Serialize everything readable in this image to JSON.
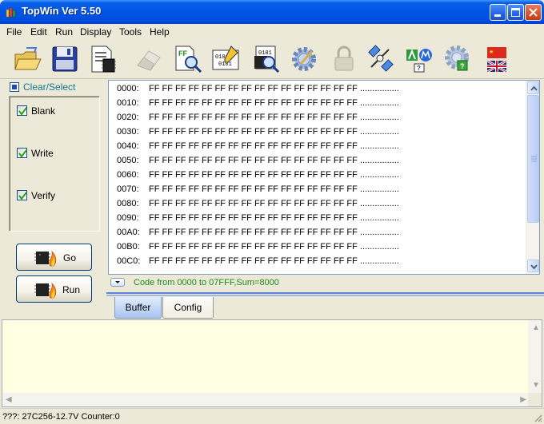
{
  "window": {
    "title": "TopWin Ver 5.50"
  },
  "menu": [
    "File",
    "Edit",
    "Run",
    "Display",
    "Tools",
    "Help"
  ],
  "toolbar": {
    "icons": [
      "open-folder-icon",
      "save-disk-icon",
      "chip-document-icon",
      "eraser-icon",
      "ff-search-icon",
      "binary-edit-icon",
      "chip-search-icon",
      "gear-icon",
      "lock-icon",
      "satellite-icon",
      "vendor-logo-icon",
      "gear-help-icon",
      "language-flags-icon"
    ]
  },
  "left_panel": {
    "clear_select": "Clear/Select",
    "options": [
      {
        "label": "Blank",
        "checked": true
      },
      {
        "label": "Write",
        "checked": true
      },
      {
        "label": "Verify",
        "checked": true
      }
    ],
    "go_button": "Go",
    "run_button": "Run"
  },
  "hex": {
    "rows": [
      {
        "addr": "0000:",
        "bytes": "FF FF FF FF FF FF FF FF FF FF FF FF FF FF FF FF",
        "ascii": "................"
      },
      {
        "addr": "0010:",
        "bytes": "FF FF FF FF FF FF FF FF FF FF FF FF FF FF FF FF",
        "ascii": "................"
      },
      {
        "addr": "0020:",
        "bytes": "FF FF FF FF FF FF FF FF FF FF FF FF FF FF FF FF",
        "ascii": "................"
      },
      {
        "addr": "0030:",
        "bytes": "FF FF FF FF FF FF FF FF FF FF FF FF FF FF FF FF",
        "ascii": "................"
      },
      {
        "addr": "0040:",
        "bytes": "FF FF FF FF FF FF FF FF FF FF FF FF FF FF FF FF",
        "ascii": "................"
      },
      {
        "addr": "0050:",
        "bytes": "FF FF FF FF FF FF FF FF FF FF FF FF FF FF FF FF",
        "ascii": "................"
      },
      {
        "addr": "0060:",
        "bytes": "FF FF FF FF FF FF FF FF FF FF FF FF FF FF FF FF",
        "ascii": "................"
      },
      {
        "addr": "0070:",
        "bytes": "FF FF FF FF FF FF FF FF FF FF FF FF FF FF FF FF",
        "ascii": "................"
      },
      {
        "addr": "0080:",
        "bytes": "FF FF FF FF FF FF FF FF FF FF FF FF FF FF FF FF",
        "ascii": "................"
      },
      {
        "addr": "0090:",
        "bytes": "FF FF FF FF FF FF FF FF FF FF FF FF FF FF FF FF",
        "ascii": "................"
      },
      {
        "addr": "00A0:",
        "bytes": "FF FF FF FF FF FF FF FF FF FF FF FF FF FF FF FF",
        "ascii": "................"
      },
      {
        "addr": "00B0:",
        "bytes": "FF FF FF FF FF FF FF FF FF FF FF FF FF FF FF FF",
        "ascii": "................"
      },
      {
        "addr": "00C0:",
        "bytes": "FF FF FF FF FF FF FF FF FF FF FF FF FF FF FF FF",
        "ascii": "................"
      }
    ],
    "summary": "Code from 0000 to 07FFF,Sum=8000"
  },
  "tabs": [
    {
      "label": "Buffer",
      "active": true
    },
    {
      "label": "Config",
      "active": false
    }
  ],
  "status_bar": {
    "text": "???: 27C256-12.7V   Counter:0"
  },
  "colors": {
    "title_blue": "#0055e5",
    "summary_green": "#1d8a20",
    "log_bg": "#ffffe1",
    "clear_select": "#0a7a8e"
  }
}
